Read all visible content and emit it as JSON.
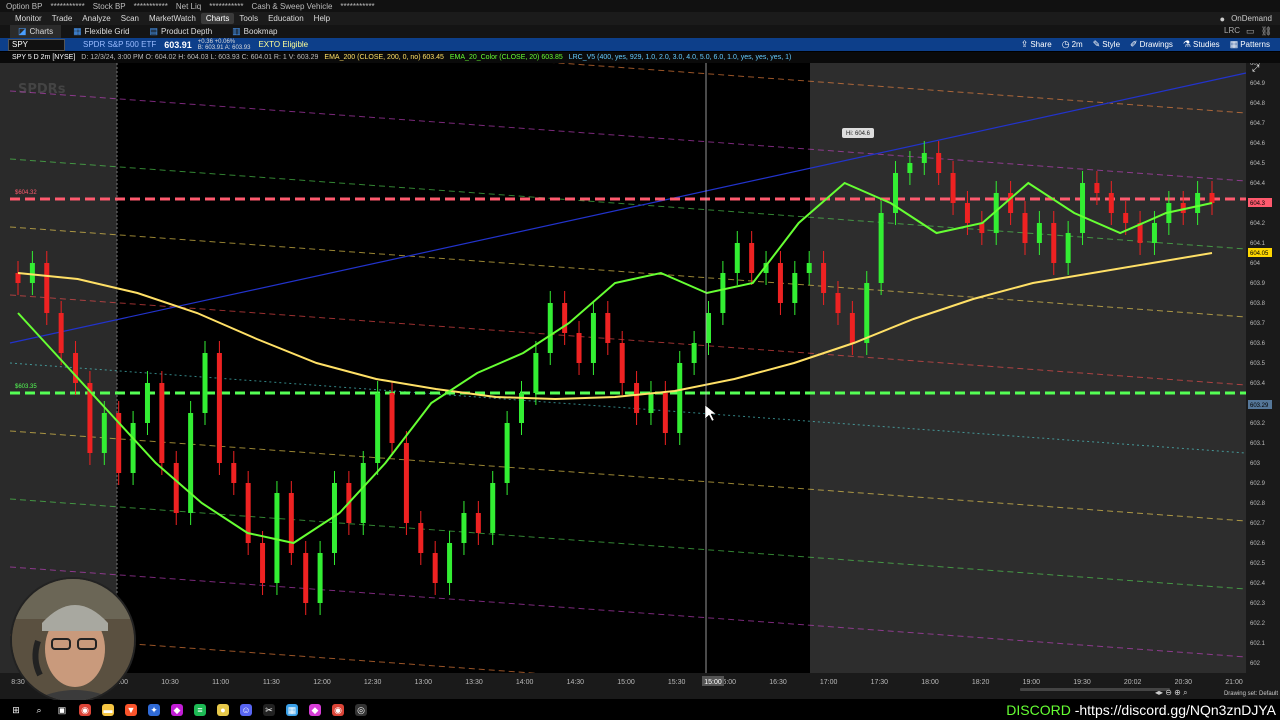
{
  "top_strip": {
    "items": [
      "Option BP",
      "***********",
      "Stock BP",
      "***********",
      "Net Liq",
      "***********",
      "Cash & Sweep Vehicle",
      "***********"
    ]
  },
  "menu": {
    "items": [
      "Monitor",
      "Trade",
      "Analyze",
      "Scan",
      "MarketWatch",
      "Charts",
      "Tools",
      "Education",
      "Help"
    ],
    "active": "Charts",
    "right_label": "OnDemand"
  },
  "tabs": {
    "items": [
      "Charts",
      "Flexible Grid",
      "Product Depth",
      "Bookmap"
    ],
    "right_label": "LRC"
  },
  "toolbar": {
    "symbol": "SPY",
    "description": "SPDR S&P 500 ETF",
    "price": "603.91",
    "change_line1": "+0.36 +0.06%",
    "change_line2": "B: 603.91  A: 603.93",
    "etb": "EXTO Eligible",
    "tools": [
      "Share",
      "2m",
      "Style",
      "Drawings",
      "Studies",
      "Patterns"
    ]
  },
  "infoline": {
    "items": [
      {
        "text": "SPY 5 D 2m [NYSE]",
        "color": "#ffffff"
      },
      {
        "text": "D: 12/3/24, 3:00 PM  O: 604.02  H: 604.03  L: 603.93  C: 604.01  R: 1  V: 603.29",
        "color": "#bbbbbb"
      },
      {
        "text": "EMA_200 (CLOSE, 200, 0, no)  603.45",
        "color": "#ffe066"
      },
      {
        "text": "EMA_20_Color (CLOSE, 20)  603.85",
        "color": "#66ff33"
      },
      {
        "text": "LRC_V5 (400, yes, 929, 1.0, 2.0, 3.0, 4.0, 5.0, 6.0, 1.0, yes, yes, yes, 1)",
        "color": "#66ccff"
      }
    ]
  },
  "chart_data": {
    "type": "candlestick",
    "symbol": "SPY",
    "interval": "2m",
    "watermark": "SPDRs",
    "high_label": "Hi: 604.6",
    "price_levels": {
      "resistance": {
        "value": 604.32,
        "label": "$604.32",
        "color": "#ff5a6e"
      },
      "support": {
        "value": 603.35,
        "label": "$603.35",
        "color": "#55ff55"
      }
    },
    "y_axis": {
      "ylim": [
        601.95,
        605.0
      ],
      "ticks": [
        "605",
        "604.9",
        "604.8",
        "604.7",
        "604.6",
        "604.5",
        "604.4",
        "604.3",
        "604.2",
        "604.1",
        "604",
        "603.9",
        "603.8",
        "603.7",
        "603.6",
        "603.5",
        "603.4",
        "603.3",
        "603.2",
        "603.1",
        "603",
        "602.9",
        "602.8",
        "602.7",
        "602.6",
        "602.5",
        "602.4",
        "602.3",
        "602.2",
        "602.1",
        "602"
      ],
      "current_price_tags": [
        {
          "label": "604.3",
          "value": 604.3,
          "color": "#ff5a6e"
        },
        {
          "label": "604.05",
          "value": 604.05,
          "color": "#ffd700"
        },
        {
          "label": "603.29",
          "value": 603.29,
          "color": "#557799"
        }
      ]
    },
    "x_axis": {
      "ticks": [
        "8:30",
        "9:30",
        "10:00",
        "10:30",
        "11:00",
        "11:30",
        "12:00",
        "12:30",
        "13:00",
        "13:30",
        "14:00",
        "14:30",
        "15:00",
        "15:30",
        "16:00",
        "16:30",
        "17:00",
        "17:30",
        "18:00",
        "18:20",
        "19:00",
        "19:30",
        "20:02",
        "20:30",
        "21:00"
      ],
      "crosshair_label": "15:00"
    },
    "sessions": {
      "premarket_end": "9:30",
      "afterhours_start": "16:00"
    },
    "closes": [
      603.9,
      604.0,
      603.75,
      603.55,
      603.4,
      603.05,
      603.25,
      602.95,
      603.2,
      603.4,
      603.0,
      602.75,
      603.25,
      603.55,
      603.0,
      602.9,
      602.6,
      602.4,
      602.85,
      602.55,
      602.3,
      602.55,
      602.9,
      602.7,
      603.0,
      603.35,
      603.1,
      602.7,
      602.55,
      602.4,
      602.6,
      602.75,
      602.65,
      602.9,
      603.2,
      603.35,
      603.55,
      603.8,
      603.65,
      603.5,
      603.75,
      603.6,
      603.4,
      603.25,
      603.35,
      603.15,
      603.5,
      603.6,
      603.75,
      603.95,
      604.1,
      603.95,
      604.0,
      603.8,
      603.95,
      604.0,
      603.85,
      603.75,
      603.6,
      603.9,
      604.25,
      604.45,
      604.5,
      604.55,
      604.45,
      604.3,
      604.2,
      604.15,
      604.35,
      604.25,
      604.1,
      604.2,
      604.0,
      604.15,
      604.4,
      604.35,
      604.25,
      604.2,
      604.1,
      604.2,
      604.3,
      604.25,
      604.35,
      604.3
    ],
    "ema_200": [
      603.95,
      603.92,
      603.85,
      603.75,
      603.62,
      603.5,
      603.42,
      603.37,
      603.33,
      603.32,
      603.33,
      603.36,
      603.42,
      603.5,
      603.6,
      603.72,
      603.82,
      603.9,
      603.95,
      604.0,
      604.05
    ],
    "ema_20": [
      603.75,
      603.5,
      603.25,
      603.0,
      602.8,
      602.65,
      602.6,
      602.75,
      603.0,
      603.3,
      603.45,
      603.55,
      603.7,
      603.9,
      603.95,
      603.85,
      603.9,
      604.2,
      604.4,
      604.3,
      604.15,
      604.2,
      604.4,
      604.25,
      604.15,
      604.25,
      604.3
    ],
    "lrc_band_colors": [
      "#ff8c42",
      "#cc44cc",
      "#55dd55",
      "#ffdd55",
      "#ff5050",
      "#55dddd",
      "#ffdd55",
      "#55dd55",
      "#cc44cc",
      "#ff8c42"
    ]
  },
  "webcam": {
    "label": "Presenter webcam"
  },
  "taskbar": {
    "icons": [
      {
        "name": "windows-icon",
        "glyph": "⊞",
        "color": "#000000"
      },
      {
        "name": "search-icon",
        "glyph": "⌕",
        "color": "#000000"
      },
      {
        "name": "task-view-icon",
        "glyph": "▣",
        "color": "#000000"
      },
      {
        "name": "chrome-icon",
        "glyph": "◉",
        "color": "#db4437"
      },
      {
        "name": "file-explorer-icon",
        "glyph": "▬",
        "color": "#f5c542"
      },
      {
        "name": "brave-icon",
        "glyph": "▼",
        "color": "#fb542b"
      },
      {
        "name": "thinkorswim-icon",
        "glyph": "✦",
        "color": "#2f6ad6"
      },
      {
        "name": "app-diamond-icon",
        "glyph": "◆",
        "color": "#c21dd6"
      },
      {
        "name": "spotify-icon",
        "glyph": "≡",
        "color": "#1db954"
      },
      {
        "name": "app-yellow-icon",
        "glyph": "●",
        "color": "#e6c84a"
      },
      {
        "name": "discord-app-icon",
        "glyph": "☺",
        "color": "#5865f2"
      },
      {
        "name": "capcut-icon",
        "glyph": "✂",
        "color": "#222222"
      },
      {
        "name": "app-blue-icon",
        "glyph": "▦",
        "color": "#3aa0e8"
      },
      {
        "name": "app-magenta-icon",
        "glyph": "◆",
        "color": "#d63cd6"
      },
      {
        "name": "chrome-2-icon",
        "glyph": "◉",
        "color": "#db4437"
      },
      {
        "name": "obs-icon",
        "glyph": "◎",
        "color": "#333333"
      }
    ],
    "discord_label": "DISCORD",
    "discord_link": "-https://discord.gg/NQn3znDJYA"
  },
  "drawing_set": "Drawing set: Default"
}
